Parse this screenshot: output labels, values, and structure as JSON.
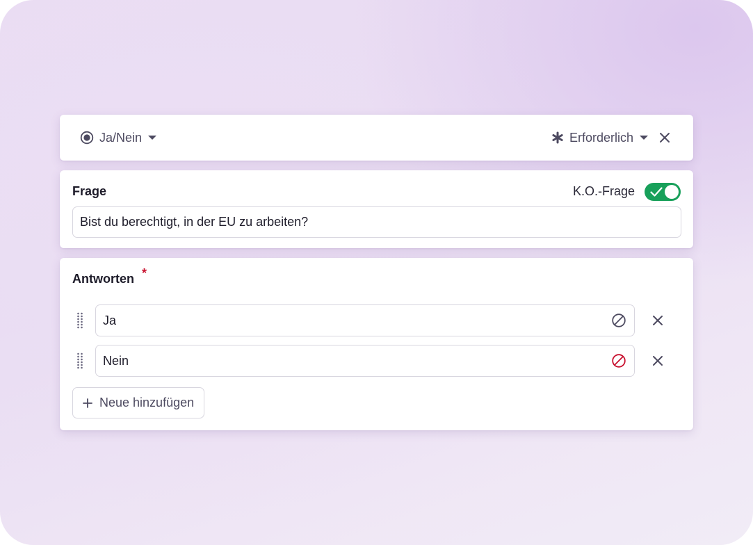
{
  "type_selector": {
    "label": "Ja/Nein",
    "icon": "radio-button-icon"
  },
  "required_selector": {
    "label": "Erforderlich",
    "icon": "asterisk-icon"
  },
  "question_card": {
    "title": "Frage",
    "ko_label": "K.O.-Frage",
    "ko_enabled": true,
    "question_value": "Bist du berechtigt, in der EU zu arbeiten?"
  },
  "answers_card": {
    "title": "Antworten",
    "required_marker": "*",
    "answers": [
      {
        "value": "Ja",
        "ko_active": false
      },
      {
        "value": "Nein",
        "ko_active": true
      }
    ],
    "add_label": "Neue hinzufügen"
  },
  "colors": {
    "toggle_on": "#18a05a",
    "ko_active": "#c8102e",
    "ko_inactive": "#4d4a60",
    "required_star": "#c8102e"
  }
}
